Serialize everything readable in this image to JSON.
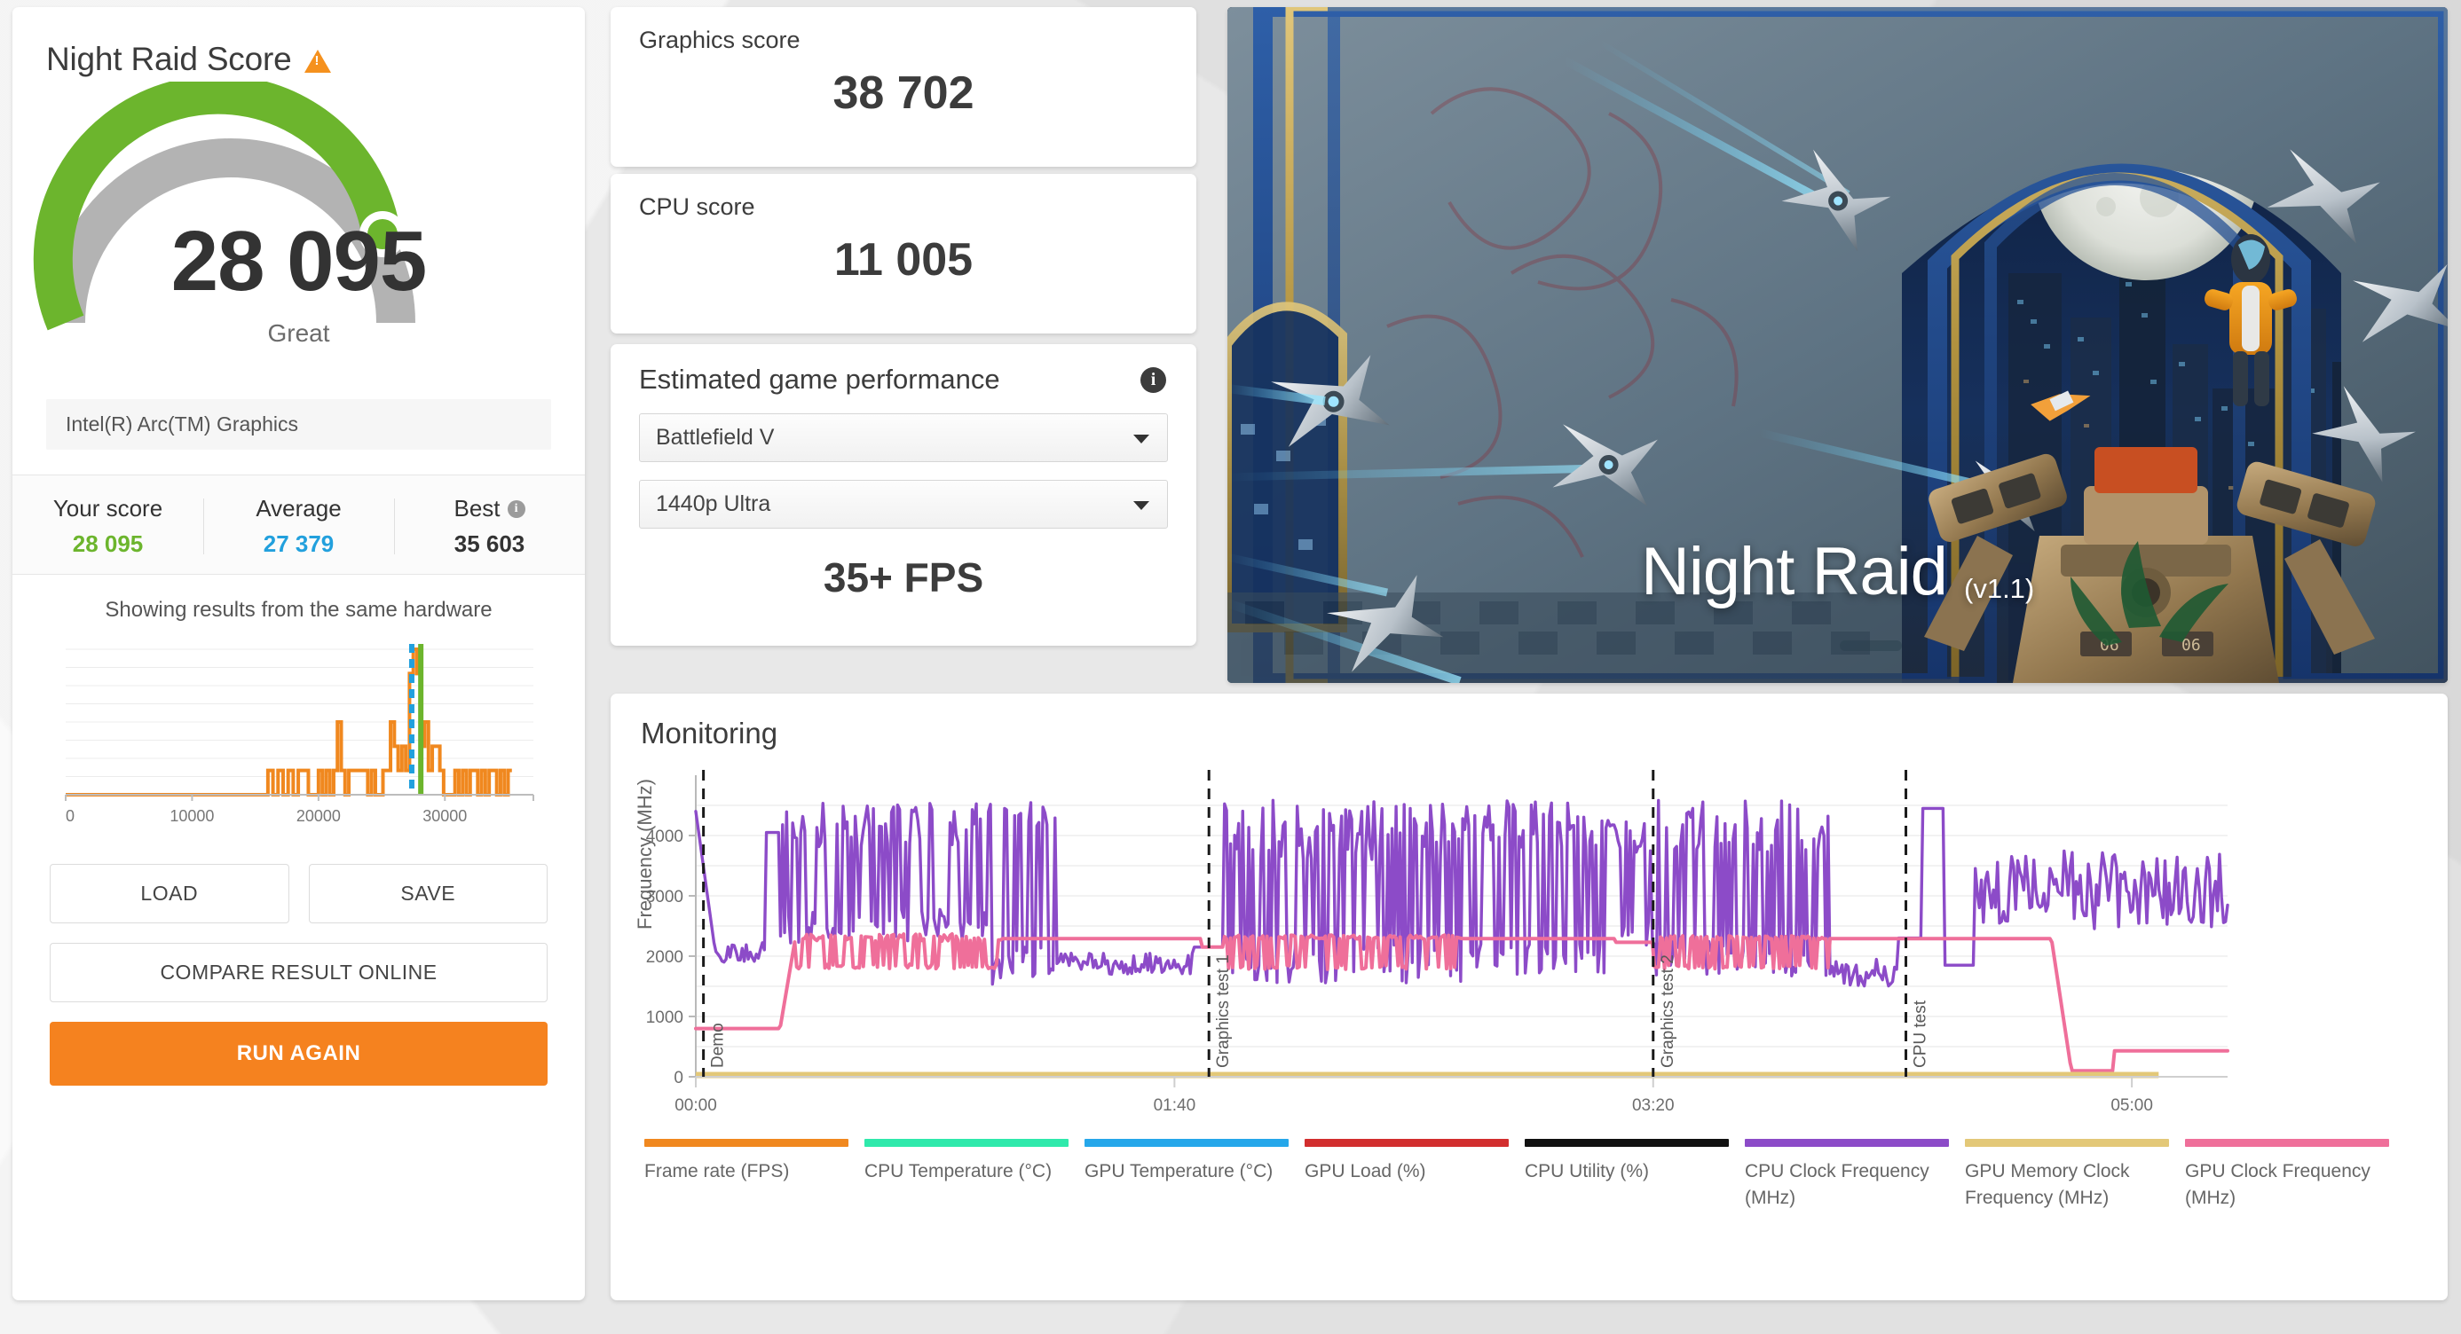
{
  "left_panel": {
    "title": "Night Raid Score",
    "warning_icon": "warning-triangle-icon",
    "score": "28 095",
    "rating": "Great",
    "device": "Intel(R) Arc(TM) Graphics",
    "gauge": {
      "percent": 79,
      "color": "#6cb52d",
      "track_color": "#b3b3b3"
    },
    "comparison": {
      "your_score_label": "Your score",
      "your_score_value": "28 095",
      "your_score_color": "#6cb52d",
      "average_label": "Average",
      "average_value": "27 379",
      "average_color": "#22a0dd",
      "best_label": "Best",
      "best_value": "35 603",
      "best_color": "#333333",
      "best_info_icon": "info-icon"
    },
    "histogram_title": "Showing results from the same hardware",
    "buttons": {
      "load": "LOAD",
      "save": "SAVE",
      "compare": "COMPARE RESULT ONLINE",
      "run_again": "RUN AGAIN",
      "run_again_color": "#f5821f"
    }
  },
  "scores": {
    "graphics_label": "Graphics score",
    "graphics_value": "38 702",
    "cpu_label": "CPU score",
    "cpu_value": "11 005"
  },
  "estimated_game_performance": {
    "title": "Estimated game performance",
    "info_icon": "info-icon",
    "game": "Battlefield V",
    "preset": "1440p Ultra",
    "fps": "35+ FPS",
    "caret_icon": "chevron-down-icon"
  },
  "hero": {
    "title": "Night Raid",
    "version": "(v1.1)"
  },
  "monitoring": {
    "title": "Monitoring"
  },
  "chart_data": [
    {
      "id": "score-histogram",
      "type": "area",
      "title": "Showing results from the same hardware",
      "xlabel": "",
      "ylabel": "",
      "xlim": [
        0,
        37000
      ],
      "xticks": [
        0,
        10000,
        20000,
        30000
      ],
      "xtick_labels": [
        "0",
        "10000",
        "20000",
        "30000"
      ],
      "grid": true,
      "series": [
        {
          "name": "Result distribution",
          "color": "#f0881f",
          "x": [
            0,
            1000,
            2000,
            3000,
            4000,
            5000,
            6000,
            7000,
            8000,
            9000,
            10000,
            11000,
            12000,
            13000,
            14000,
            15000,
            15600,
            16000,
            16400,
            16800,
            17200,
            17600,
            18000,
            18400,
            18800,
            19200,
            19600,
            20000,
            20300,
            20600,
            20900,
            21200,
            21500,
            21800,
            22100,
            22400,
            22700,
            23000,
            23300,
            23600,
            23900,
            24200,
            24500,
            24800,
            25100,
            25400,
            25700,
            26000,
            26300,
            26600,
            26900,
            27200,
            27500,
            27800,
            28100,
            28400,
            28700,
            29000,
            29300,
            29600,
            29900,
            30200,
            30500,
            30800,
            31100,
            31400,
            31700,
            32000,
            32300,
            32600,
            32900,
            33200,
            33500,
            33800,
            34100,
            34400,
            34700,
            35000,
            35300
          ],
          "y": [
            0,
            0,
            0,
            0,
            0,
            0,
            0,
            0,
            0,
            0,
            0,
            0,
            0,
            0,
            0,
            0,
            0,
            1,
            0,
            1,
            0,
            1,
            0,
            1,
            1,
            0,
            0,
            1,
            0,
            1,
            0,
            1,
            3,
            1,
            0,
            1,
            1,
            1,
            1,
            1,
            0,
            1,
            0,
            0,
            1,
            1,
            3,
            2,
            1,
            2,
            1,
            5,
            6,
            5,
            2,
            3,
            1,
            2,
            2,
            1,
            0,
            0,
            0,
            1,
            0,
            1,
            0,
            1,
            1,
            0,
            1,
            0,
            1,
            1,
            0,
            1,
            0,
            1,
            1
          ]
        }
      ],
      "markers": [
        {
          "name": "Average",
          "x": 27379,
          "color": "#22a0dd",
          "style": "dashed"
        },
        {
          "name": "Your score",
          "x": 28095,
          "color": "#6cb52d",
          "style": "solid"
        }
      ]
    },
    {
      "id": "monitoring-chart",
      "type": "line",
      "title": "Monitoring",
      "xlabel": "",
      "ylabel": "Frequency (MHz)",
      "ylim": [
        0,
        5000
      ],
      "yticks": [
        0,
        1000,
        2000,
        3000,
        4000
      ],
      "ytick_labels": [
        "0",
        "1000",
        "2000",
        "3000",
        "4000"
      ],
      "xticks": [
        "00:00",
        "01:40",
        "03:20",
        "05:00"
      ],
      "grid": true,
      "legend_position": "bottom",
      "annotations": [
        {
          "label": "Demo",
          "x_frac": 0.005
        },
        {
          "label": "Graphics test 1",
          "x_frac": 0.335
        },
        {
          "label": "Graphics test 2",
          "x_frac": 0.625
        },
        {
          "label": "CPU test",
          "x_frac": 0.79
        }
      ],
      "series": [
        {
          "name": "Frame rate (FPS)",
          "color": "#f0881f",
          "visible_as_line": false
        },
        {
          "name": "CPU Temperature (°C)",
          "color": "#2fe9ab",
          "visible_as_line": false
        },
        {
          "name": "GPU Temperature (°C)",
          "color": "#25a7ea",
          "visible_as_line": false
        },
        {
          "name": "GPU Load (%)",
          "color": "#d22e2e",
          "visible_as_line": false
        },
        {
          "name": "CPU Utility (%)",
          "color": "#111111",
          "visible_as_line": false
        },
        {
          "name": "CPU Clock Frequency (MHz)",
          "color": "#8c4bc8",
          "visible_as_line": true
        },
        {
          "name": "GPU Memory Clock Frequency (MHz)",
          "color": "#e3c878",
          "visible_as_line": true
        },
        {
          "name": "GPU Clock Frequency (MHz)",
          "color": "#ef6f9a",
          "visible_as_line": true
        }
      ]
    }
  ],
  "monitoring_legend": [
    {
      "label": "Frame rate (FPS)",
      "color": "#f0881f"
    },
    {
      "label": "CPU Temperature (°C)",
      "color": "#2fe9ab"
    },
    {
      "label": "GPU Temperature (°C)",
      "color": "#25a7ea"
    },
    {
      "label": "GPU Load (%)",
      "color": "#d22e2e"
    },
    {
      "label": "CPU Utility (%)",
      "color": "#111111"
    },
    {
      "label": "CPU Clock Frequency (MHz)",
      "color": "#8c4bc8"
    },
    {
      "label": "GPU Memory Clock Frequency (MHz)",
      "color": "#e3c878"
    },
    {
      "label": "GPU Clock Frequency (MHz)",
      "color": "#ef6f9a"
    }
  ],
  "monitoring_axis": {
    "ylabel": "Frequency (MHz)",
    "yticks": [
      "4000",
      "3000",
      "2000",
      "1000",
      "0"
    ],
    "xticks": [
      "00:00",
      "01:40",
      "03:20",
      "05:00"
    ],
    "markers": [
      "Demo",
      "Graphics test 1",
      "Graphics test 2",
      "CPU test"
    ]
  }
}
